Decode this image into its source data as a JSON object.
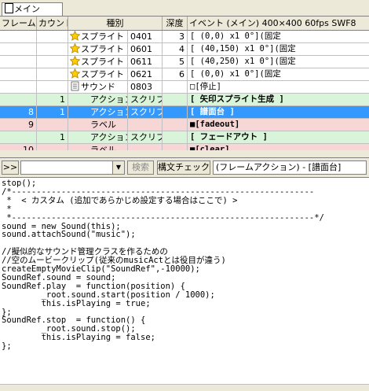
{
  "tab": {
    "icon": "tab-icon",
    "label": "メイン"
  },
  "columns": [
    "フレーム",
    "カウント",
    "種別",
    "深度",
    "イベント (メイン)  400×400  60fps  SWF8"
  ],
  "rows": [
    {
      "frame": "",
      "count": "",
      "type": "スプライト",
      "kind_icon": "star-icon",
      "id": "0401",
      "depth": "3",
      "event": "[       (0,0)        x1    0°](固定",
      "bg": "#ffffff"
    },
    {
      "frame": "",
      "count": "",
      "type": "スプライト",
      "kind_icon": "star-icon",
      "id": "0601",
      "depth": "4",
      "event": "[    (40,150)        x1    0°](固定",
      "bg": "#ffffff"
    },
    {
      "frame": "",
      "count": "",
      "type": "スプライト",
      "kind_icon": "star-icon",
      "id": "0611",
      "depth": "5",
      "event": "[    (40,250)        x1    0°](固定",
      "bg": "#ffffff"
    },
    {
      "frame": "",
      "count": "",
      "type": "スプライト",
      "kind_icon": "star-icon",
      "id": "0621",
      "depth": "6",
      "event": "[       (0,0)        x1    0°](固定",
      "bg": "#ffffff"
    },
    {
      "frame": "",
      "count": "",
      "type": "サウンド",
      "kind_icon": "sound-icon",
      "id": "0803",
      "depth": "",
      "event": "□[停止]",
      "bg": "#ffffff"
    },
    {
      "frame": "",
      "count": "1",
      "type": "アクション",
      "kind_icon": "",
      "id": "スクリプト",
      "depth": "",
      "event": "[ 矢印スプライト生成 ]",
      "bg": "#d9f5d9",
      "bold": true
    },
    {
      "frame": "8",
      "count": "1",
      "type": "アクション",
      "kind_icon": "",
      "id": "スクリプト",
      "depth": "",
      "event": "[ 譜面台 ]",
      "bg": "#3399ff",
      "bold": true,
      "selected": true
    },
    {
      "frame": "9",
      "count": "",
      "type": "ラベル",
      "kind_icon": "",
      "id": "",
      "depth": "",
      "event": "■[fadeout]",
      "bg": "#f7d6d6",
      "bold": true
    },
    {
      "frame": "",
      "count": "1",
      "type": "アクション",
      "kind_icon": "",
      "id": "スクリプト",
      "depth": "",
      "event": "[ フェードアウト ]",
      "bg": "#d9f5d9",
      "bold": true
    },
    {
      "frame": "10",
      "count": "",
      "type": "ラベル",
      "kind_icon": "",
      "id": "",
      "depth": "",
      "event": "■[clear]",
      "bg": "#f7d6d6",
      "bold": true
    }
  ],
  "toolbar": {
    "nav_label": ">>",
    "combo_value": "",
    "search_label": "検索",
    "syntax_check_label": "構文チェック",
    "title_field": "(フレームアクション) - [譜面台]"
  },
  "code": [
    "stop();",
    "/*-------------------------------------------------------------",
    " *  < カスタム (追加であらかじめ設定する場合はここで) >",
    " *",
    " *-------------------------------------------------------------*/",
    "sound = new Sound(this);",
    "sound.attachSound(\"music\");",
    "",
    "//擬似的なサウンド管理クラスを作るための",
    "//空のムービークリップ(従来のmusicActとは役目が違う)",
    "createEmptyMovieClip(\"SoundRef\",-10000);",
    "SoundRef.sound = sound;",
    "SoundRef.play  = function(position) {",
    "        _root.sound.start(position / 1000);",
    "        this.isPlaying = true;",
    "};",
    "SoundRef.stop  = function() {",
    "        _root.sound.stop();",
    "        this.isPlaying = false;",
    "};"
  ]
}
